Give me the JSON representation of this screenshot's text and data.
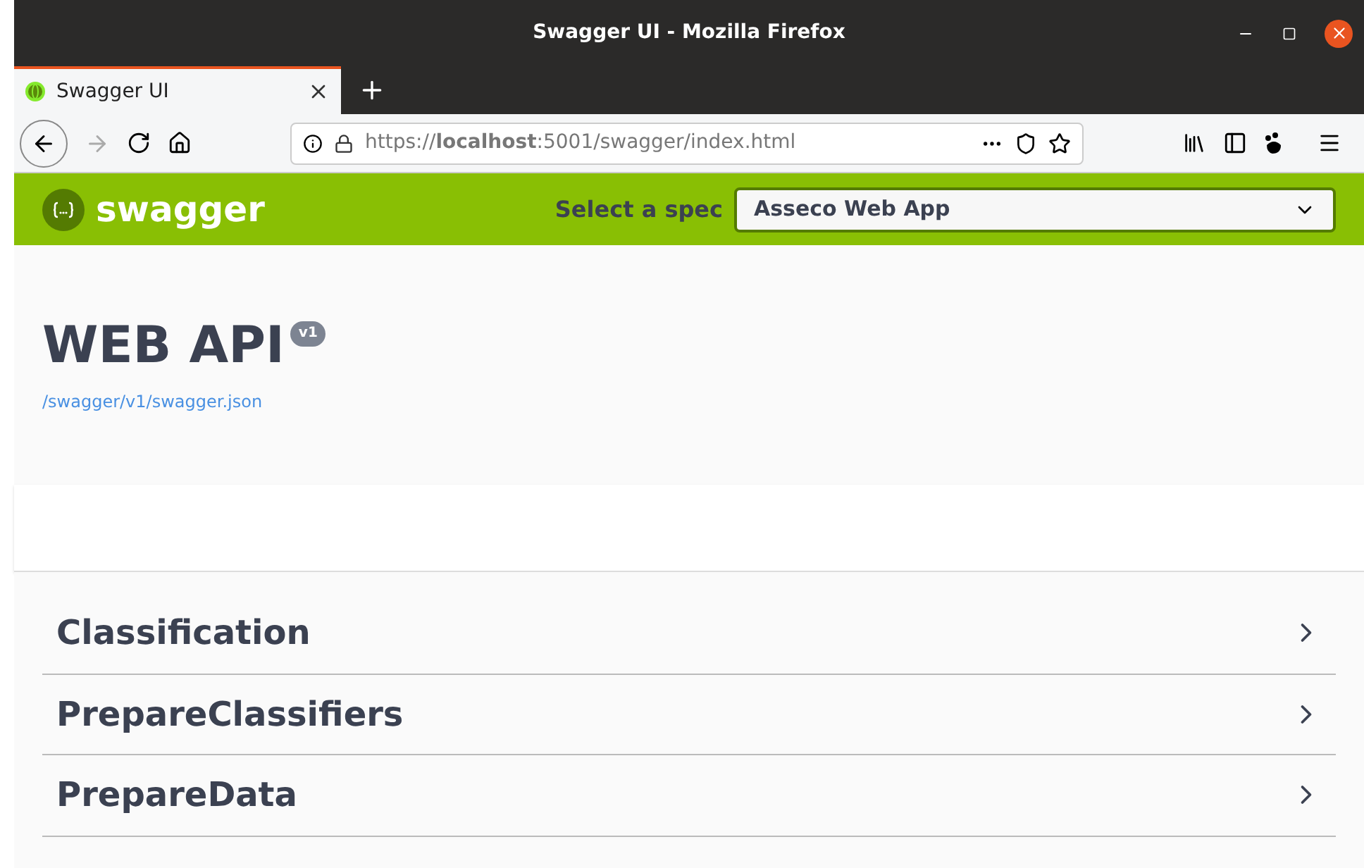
{
  "window": {
    "title": "Swagger UI - Mozilla Firefox"
  },
  "tabs": [
    {
      "label": "Swagger UI",
      "selected": true
    }
  ],
  "address_bar": {
    "url": "https://**localhost**:5001/swagger/index.html"
  },
  "header": {
    "logo": "swagger",
    "spec_label": "Select a spec",
    "spec_value": "Asseco Web App"
  },
  "info": {
    "title": "WEB API",
    "version": "v1",
    "link": "/swagger/v1/swagger.json"
  },
  "sections": [
    {
      "name": "Classification",
      "expanded": false
    },
    {
      "name": "PrepareClassifiers",
      "expanded": false
    },
    {
      "name": "PrepareData",
      "expanded": false
    }
  ]
}
